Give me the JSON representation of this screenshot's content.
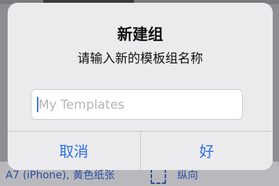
{
  "background": {
    "bottom_text": "A7 (iPhone), 黄色纸张",
    "orientation_label": "纵向"
  },
  "dialog": {
    "title": "新建组",
    "message": "请输入新的模板组名称",
    "input": {
      "placeholder": "My Templates",
      "value": ""
    },
    "cancel_label": "取消",
    "ok_label": "好"
  },
  "colors": {
    "accent": "#2f6fe0",
    "dialog_bg": "#ebebed"
  }
}
